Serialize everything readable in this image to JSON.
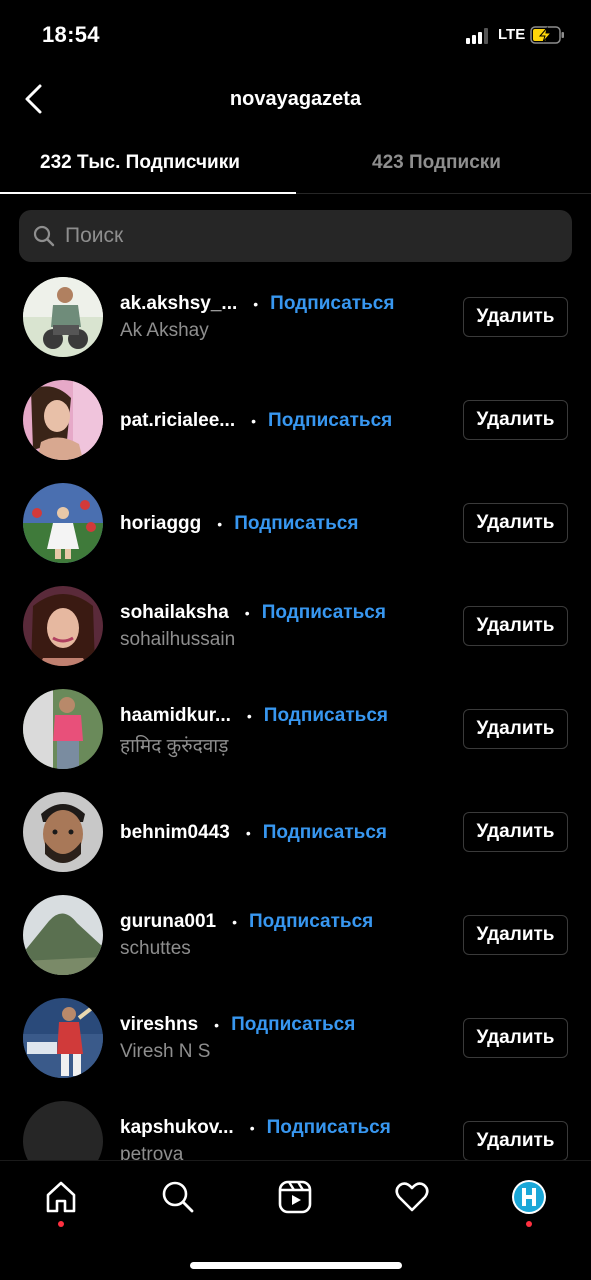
{
  "status_bar": {
    "time": "18:54",
    "network": "LTE"
  },
  "header": {
    "title": "novayagazeta"
  },
  "tabs": [
    {
      "label": "232 Тыс. Подписчики",
      "active": true
    },
    {
      "label": "423 Подписки",
      "active": false
    }
  ],
  "search": {
    "placeholder": "Поиск"
  },
  "list": [
    {
      "username": "ak.akshsy_...",
      "follow": "Подписаться",
      "fullname": "Ak Akshay",
      "remove": "Удалить"
    },
    {
      "username": "pat.ricialee...",
      "follow": "Подписаться",
      "fullname": "",
      "remove": "Удалить"
    },
    {
      "username": "horiaggg",
      "follow": "Подписаться",
      "fullname": "",
      "remove": "Удалить"
    },
    {
      "username": "sohailaksha",
      "follow": "Подписаться",
      "fullname": "sohailhussain",
      "remove": "Удалить"
    },
    {
      "username": "haamidkur...",
      "follow": "Подписаться",
      "fullname": "हामिद कुरुंदवाड़",
      "remove": "Удалить"
    },
    {
      "username": "behnim0443",
      "follow": "Подписаться",
      "fullname": "",
      "remove": "Удалить"
    },
    {
      "username": "guruna001",
      "follow": "Подписаться",
      "fullname": "schuttes",
      "remove": "Удалить"
    },
    {
      "username": "vireshns",
      "follow": "Подписаться",
      "fullname": "Viresh N S",
      "remove": "Удалить"
    },
    {
      "username": "kapshukov...",
      "follow": "Подписаться",
      "fullname": "petrova",
      "remove": "Удалить"
    }
  ],
  "tabbar": {
    "icons": [
      "home-icon",
      "search-icon",
      "reels-icon",
      "heart-icon",
      "profile-avatar"
    ]
  },
  "colors": {
    "background": "#000000",
    "accent": "#3897f0",
    "secondary_text": "#8e8e8e",
    "notification": "#ff3040"
  }
}
